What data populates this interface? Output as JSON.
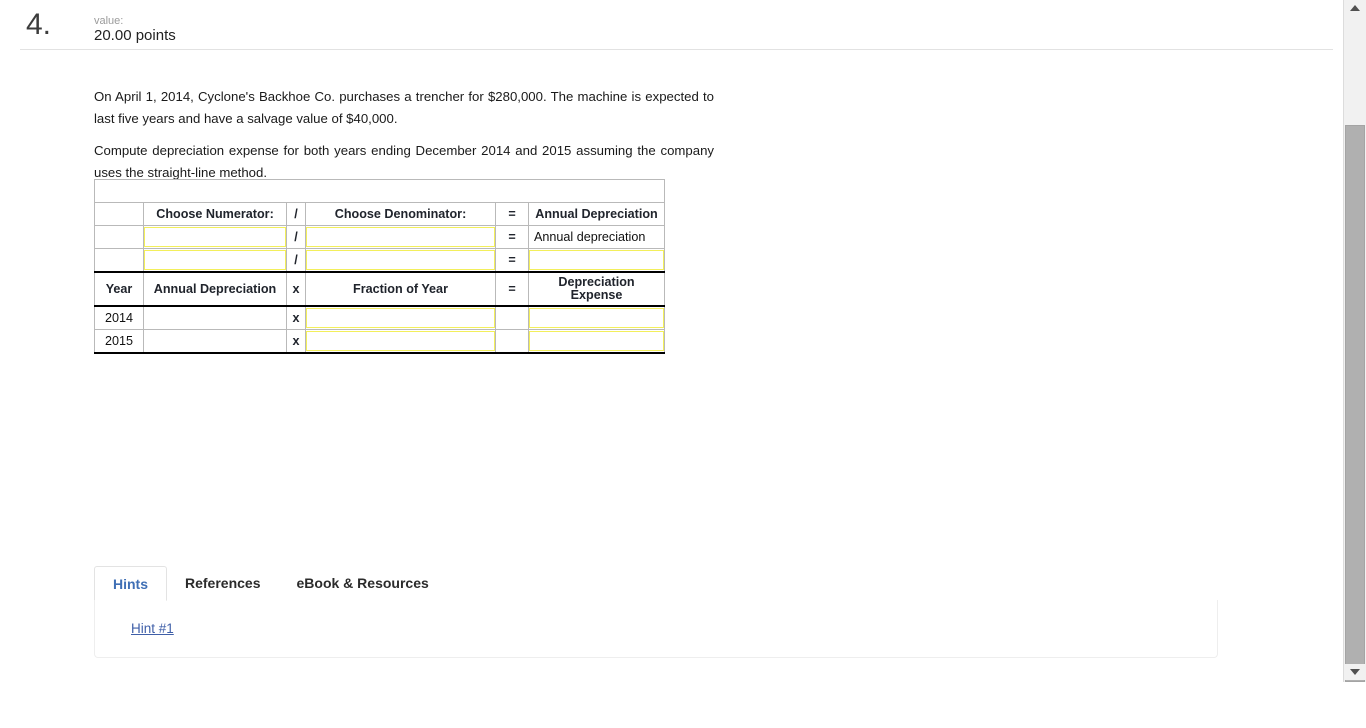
{
  "question": {
    "number": "4.",
    "value_label": "value:",
    "points": "20.00 points",
    "paragraph1": "On April 1, 2014, Cyclone's Backhoe Co. purchases a trencher for $280,000. The machine is expected to last five years and have a salvage value of $40,000.",
    "paragraph2": "Compute depreciation expense for both years ending December 2014 and 2015 assuming the company uses the straight-line method."
  },
  "worksheet": {
    "table1": {
      "headers": {
        "blank": "",
        "numerator": "Choose Numerator:",
        "divide": "/",
        "denominator": "Choose Denominator:",
        "equals": "=",
        "result": "Annual Depreciation"
      },
      "rows": [
        {
          "label": "",
          "numerator_value": "",
          "op": "/",
          "denominator_value": "",
          "eq": "=",
          "result_text": "Annual depreciation",
          "result_is_input": false
        },
        {
          "label": "",
          "numerator_value": "",
          "op": "/",
          "denominator_value": "",
          "eq": "=",
          "result_text": "",
          "result_is_input": true
        }
      ]
    },
    "table2": {
      "headers": {
        "year": "Year",
        "annual_depreciation": "Annual Depreciation",
        "times": "x",
        "fraction": "Fraction of Year",
        "equals": "=",
        "expense_line1": "Depreciation",
        "expense_line2": "Expense"
      },
      "rows": [
        {
          "year": "2014",
          "annual_depreciation": "",
          "op": "x",
          "fraction": "",
          "eq": "",
          "expense": ""
        },
        {
          "year": "2015",
          "annual_depreciation": "",
          "op": "x",
          "fraction": "",
          "eq": "",
          "expense": ""
        }
      ]
    }
  },
  "tabs": [
    {
      "label": "Hints",
      "active": true
    },
    {
      "label": "References",
      "active": false
    },
    {
      "label": "eBook & Resources",
      "active": false
    }
  ],
  "hints": {
    "link": "Hint #1"
  },
  "colors": {
    "header_blue": "#8aa8d8",
    "input_yellow": "#f3ef5b",
    "active_tab_text": "#3f6fb5",
    "link": "#3f5fa8"
  }
}
